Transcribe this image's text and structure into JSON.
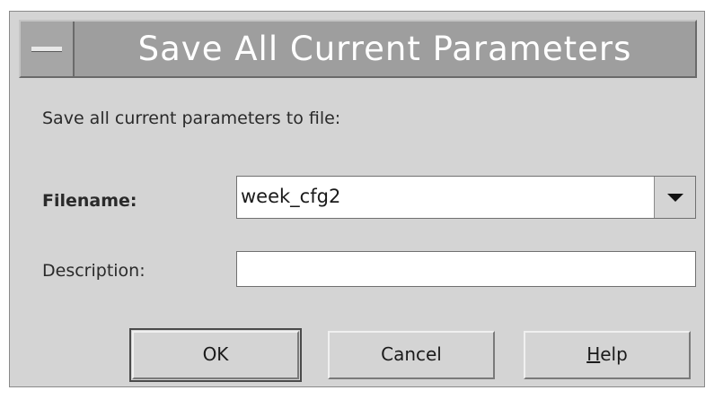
{
  "dialog": {
    "title": "Save All Current Parameters",
    "prompt": "Save all current parameters to file:"
  },
  "filename": {
    "label": "Filename:",
    "value": "week_cfg2"
  },
  "description": {
    "label": "Description:",
    "value": ""
  },
  "buttons": {
    "ok_label": "OK",
    "cancel_label": "Cancel",
    "help_mnemonic": "H",
    "help_rest": "elp"
  },
  "icons": {
    "window_menu": "window-menu-icon",
    "dropdown": "chevron-down-icon"
  }
}
